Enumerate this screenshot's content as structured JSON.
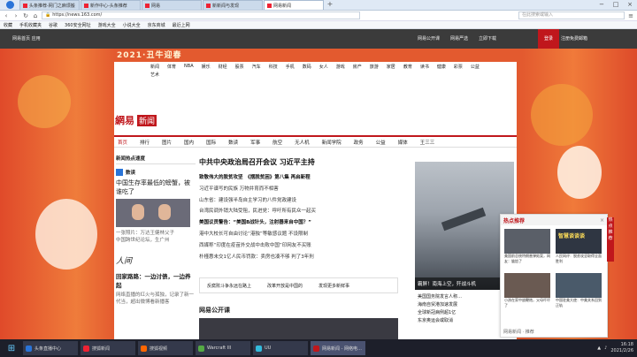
{
  "browser": {
    "tabs": [
      {
        "label": "头条推荐-网门之麻烦搬"
      },
      {
        "label": "新作中心-头条推荐"
      },
      {
        "label": "网易"
      },
      {
        "label": "新新闻与发现"
      },
      {
        "label": "网易新闻"
      }
    ],
    "url": "https://news.163.com/",
    "search_placeholder": "在此搜索或输入",
    "bookmarks": [
      "收藏",
      "手机收藏夹",
      "谷歌",
      "360安全网址",
      "游戏大全",
      "小说大全",
      "京东商城",
      "最近上网"
    ]
  },
  "site": {
    "top_left": "网易首页  应用",
    "top_right": [
      "网易公开课",
      "网易严选",
      "立即下载"
    ],
    "login_label": "登录",
    "app_download": "注册免费邮箱",
    "banner": "2021·丑牛迎春",
    "topnav": [
      "新闻",
      "体育",
      "NBA",
      "娱乐",
      "财经",
      "股票",
      "汽车",
      "科技",
      "手机",
      "数码",
      "女人",
      "游戏",
      "房产",
      "旅游",
      "家居",
      "教育",
      "读书",
      "健康",
      "彩票",
      "公益",
      "艺术"
    ],
    "brand_a": "網易",
    "brand_b": "新闻",
    "channels": [
      "首页",
      "排行",
      "图片",
      "国内",
      "国际",
      "数读",
      "军事",
      "航空",
      "无人机",
      "新闻学院",
      "政务",
      "公益",
      "媒体",
      "王三三"
    ]
  },
  "left": {
    "heading": "新闻热点速度",
    "section_label": "数读",
    "story_title": "中国生存率最低的螃蟹，被谁吃了",
    "photo_caption": "一张照片：万达王健林父子",
    "photo_sub": "中国跨世纪论坛，生广州",
    "person_label": "人间",
    "person_story": "回家路路：一边讨债，一边养起",
    "person_sub": "网络直播的红火与孤独，记录了新一代当，超出微博看新播客"
  },
  "center": {
    "headline": "中共中央政治局召开会议 习近平主持",
    "items": [
      {
        "text": "致敬伟大的脱贫攻坚　《摆脱贫困》第八集 再启新程",
        "bold": true
      },
      {
        "text": "习近平谱写的民族 万物并育而不相害",
        "bold": false
      },
      {
        "text": "山东省：建设强半岛自主学习的八件党政建设",
        "bold": false
      },
      {
        "text": "台湾民调外销大陆受阻，民进党：呼吁所有民众一起买",
        "bold": false
      },
      {
        "text": "美国议员警告：“美国B战针头，注射器来自中国？”",
        "bold": true
      },
      {
        "text": "港中大校长可自由讨论“港独”等敏感议题 不设限制",
        "bold": false
      },
      {
        "text": "西媒称“印度在疫苗外交战中击败中国”印网友不买账",
        "bold": false
      },
      {
        "text": "朴槿惠未交1亿人民币罚款：卖房也凑不够 判了3年刑",
        "bold": false
      }
    ],
    "ticker": [
      "反腐败斗争永远在路上",
      "改革开放是中国的",
      "发现更多新鲜事"
    ],
    "open_class": "网易公开课"
  },
  "right": {
    "jet_caption": "霸屏！南海上空，歼战斗机",
    "links": [
      "美国国务院发言人称…",
      "海南自贸港加速发展",
      "全球新冠病例超1亿",
      "东京奥运会或取消"
    ]
  },
  "hot": {
    "title": "热点推荐",
    "close": "×",
    "cells": [
      {
        "title": "智慧谈谈谈",
        "cap": "美国前总统特朗普弹劾案，网友：尴尬了"
      },
      {
        "title": "新闻快报",
        "cap": "人民网评：脱贫攻坚取得全面胜利"
      },
      {
        "title": "热点视频",
        "cap": "小孩在家中放鞭炮，父母吓坏了"
      },
      {
        "title": "最新消息",
        "cap": "中国驻美大使：中美关系回到正轨"
      }
    ],
    "footer": "网易新闻 · 推荐",
    "side_tab": "热点推荐"
  },
  "taskbar": {
    "items": [
      {
        "label": "头条直播中心",
        "color": "#2a74d8"
      },
      {
        "label": "搜狐新闻",
        "color": "#e23"
      },
      {
        "label": "搜狐视频",
        "color": "#f60"
      },
      {
        "label": "Warcraft III",
        "color": "#5a4"
      },
      {
        "label": "UU",
        "color": "#3bd"
      },
      {
        "label": "网易新闻 - 网络电…",
        "color": "#c0171c"
      }
    ],
    "time": "16:18",
    "date": "2021/2/26"
  }
}
